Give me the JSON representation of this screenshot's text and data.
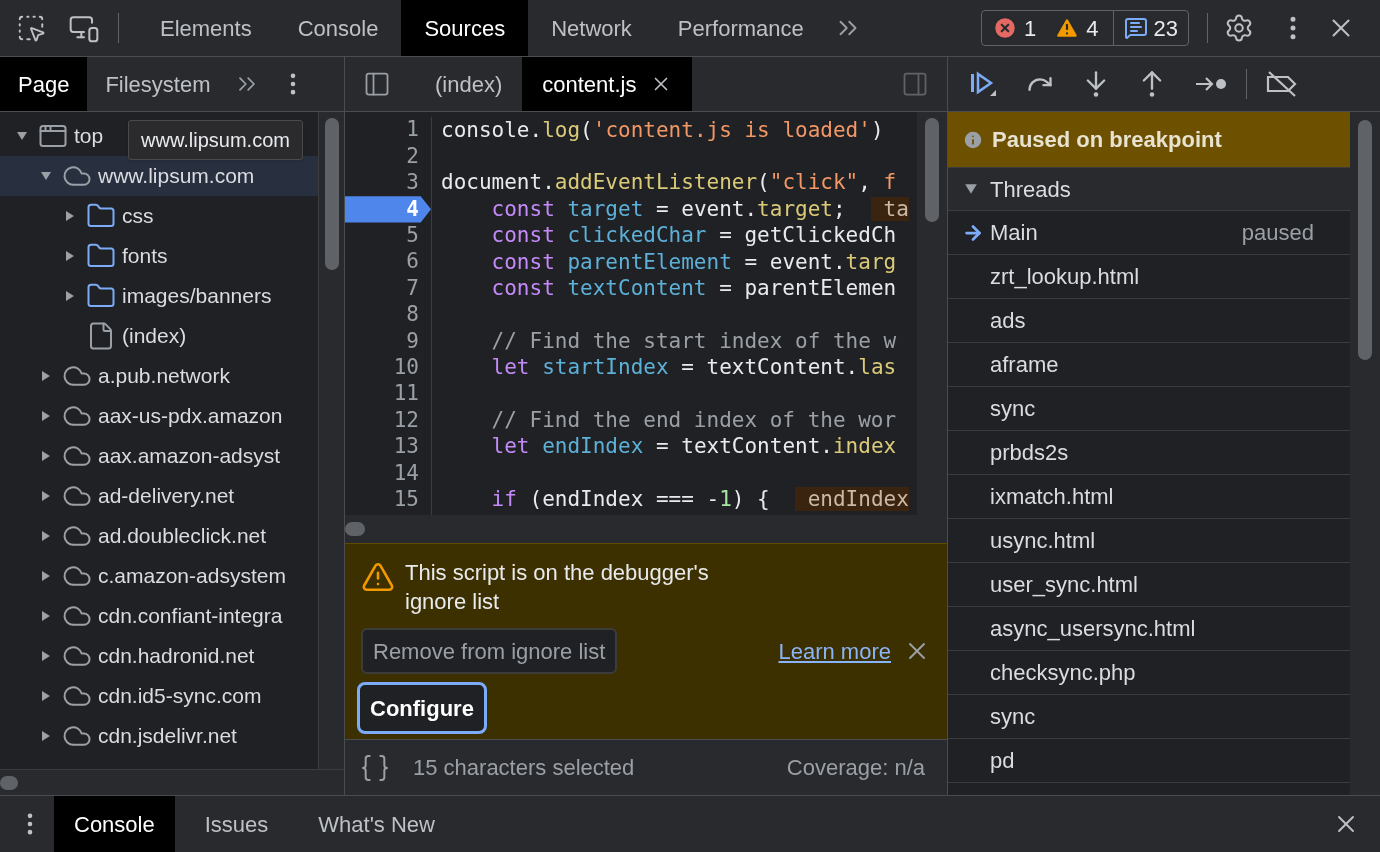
{
  "main_tabs": [
    {
      "label": "Elements",
      "selected": false
    },
    {
      "label": "Console",
      "selected": false
    },
    {
      "label": "Sources",
      "selected": true
    },
    {
      "label": "Network",
      "selected": false
    },
    {
      "label": "Performance",
      "selected": false
    }
  ],
  "counts": {
    "errors": "1",
    "warnings": "4",
    "messages": "23"
  },
  "navigator": {
    "tabs": [
      {
        "label": "Page",
        "selected": true
      },
      {
        "label": "Filesystem",
        "selected": false
      }
    ],
    "tooltip": "www.lipsum.com",
    "tree": [
      {
        "label": "top",
        "kind": "frame",
        "expanded": true,
        "selected": false,
        "children": [
          {
            "label": "www.lipsum.com",
            "kind": "domain",
            "expanded": true,
            "selected": true,
            "children": [
              {
                "label": "css",
                "kind": "folder",
                "expanded": false,
                "selected": false
              },
              {
                "label": "fonts",
                "kind": "folder",
                "expanded": false,
                "selected": false
              },
              {
                "label": "images/banners",
                "kind": "folder",
                "expanded": false,
                "selected": false
              },
              {
                "label": "(index)",
                "kind": "file",
                "selected": false
              }
            ]
          },
          {
            "label": "a.pub.network",
            "kind": "domain",
            "expanded": false,
            "selected": false
          },
          {
            "label": "aax-us-pdx.amazon",
            "kind": "domain",
            "expanded": false,
            "selected": false
          },
          {
            "label": "aax.amazon-adsyst",
            "kind": "domain",
            "expanded": false,
            "selected": false
          },
          {
            "label": "ad-delivery.net",
            "kind": "domain",
            "expanded": false,
            "selected": false
          },
          {
            "label": "ad.doubleclick.net",
            "kind": "domain",
            "expanded": false,
            "selected": false
          },
          {
            "label": "c.amazon-adsystem",
            "kind": "domain",
            "expanded": false,
            "selected": false
          },
          {
            "label": "cdn.confiant-integra",
            "kind": "domain",
            "expanded": false,
            "selected": false
          },
          {
            "label": "cdn.hadronid.net",
            "kind": "domain",
            "expanded": false,
            "selected": false
          },
          {
            "label": "cdn.id5-sync.com",
            "kind": "domain",
            "expanded": false,
            "selected": false
          },
          {
            "label": "cdn.jsdelivr.net",
            "kind": "domain",
            "expanded": false,
            "selected": false
          }
        ]
      }
    ]
  },
  "editor": {
    "tabs": [
      {
        "label": "(index)",
        "selected": false,
        "closable": false
      },
      {
        "label": "content.js",
        "selected": true,
        "closable": true
      }
    ],
    "lines": [
      {
        "number": "1",
        "breakpoint": false,
        "tokens": [
          {
            "text": "console.",
            "kind": "plain"
          },
          {
            "text": "log",
            "kind": "property"
          },
          {
            "text": "(",
            "kind": "plain"
          },
          {
            "text": "'content.js is loaded'",
            "kind": "string"
          },
          {
            "text": ")",
            "kind": "plain"
          }
        ]
      },
      {
        "number": "2",
        "breakpoint": false
      },
      {
        "number": "3",
        "breakpoint": false,
        "tokens": [
          {
            "text": "document.",
            "kind": "plain"
          },
          {
            "text": "addEventListener",
            "kind": "property"
          },
          {
            "text": "(",
            "kind": "plain"
          },
          {
            "text": "\"click\"",
            "kind": "string"
          },
          {
            "text": ", ",
            "kind": "plain"
          },
          {
            "text": "f",
            "kind": "string"
          }
        ]
      },
      {
        "number": "4",
        "breakpoint": true,
        "tokens": [
          {
            "text": "    const",
            "kind": "keyword"
          },
          {
            "text": " target",
            "kind": "variable"
          },
          {
            "text": " = event.",
            "kind": "plain"
          },
          {
            "text": "target",
            "kind": "property"
          },
          {
            "text": ";  ",
            "kind": "plain"
          },
          {
            "text": " ta",
            "kind": "inline"
          }
        ]
      },
      {
        "number": "5",
        "breakpoint": false,
        "tokens": [
          {
            "text": "    const",
            "kind": "keyword"
          },
          {
            "text": " clickedChar",
            "kind": "variable"
          },
          {
            "text": " = getClickedCh",
            "kind": "plain"
          }
        ]
      },
      {
        "number": "6",
        "breakpoint": false,
        "tokens": [
          {
            "text": "    const",
            "kind": "keyword"
          },
          {
            "text": " parentElement",
            "kind": "variable"
          },
          {
            "text": " = event.",
            "kind": "plain"
          },
          {
            "text": "targ",
            "kind": "property"
          }
        ]
      },
      {
        "number": "7",
        "breakpoint": false,
        "tokens": [
          {
            "text": "    const",
            "kind": "keyword"
          },
          {
            "text": " textContent",
            "kind": "variable"
          },
          {
            "text": " = parentElemen",
            "kind": "plain"
          }
        ]
      },
      {
        "number": "8",
        "breakpoint": false
      },
      {
        "number": "9",
        "breakpoint": false,
        "tokens": [
          {
            "text": "    // Find the start index of the w",
            "kind": "comment"
          }
        ]
      },
      {
        "number": "10",
        "breakpoint": false,
        "tokens": [
          {
            "text": "    let",
            "kind": "keyword"
          },
          {
            "text": " startIndex",
            "kind": "variable"
          },
          {
            "text": " = textContent.",
            "kind": "plain"
          },
          {
            "text": "las",
            "kind": "property"
          }
        ]
      },
      {
        "number": "11",
        "breakpoint": false
      },
      {
        "number": "12",
        "breakpoint": false,
        "tokens": [
          {
            "text": "    // Find the end index of the wor",
            "kind": "comment"
          }
        ]
      },
      {
        "number": "13",
        "breakpoint": false,
        "tokens": [
          {
            "text": "    let",
            "kind": "keyword"
          },
          {
            "text": " endIndex",
            "kind": "variable"
          },
          {
            "text": " = textContent.",
            "kind": "plain"
          },
          {
            "text": "index",
            "kind": "property"
          }
        ]
      },
      {
        "number": "14",
        "breakpoint": false
      },
      {
        "number": "15",
        "breakpoint": false,
        "tokens": [
          {
            "text": "    if",
            "kind": "keyword"
          },
          {
            "text": " (endIndex === -",
            "kind": "plain"
          },
          {
            "text": "1",
            "kind": "number"
          },
          {
            "text": ") {  ",
            "kind": "plain"
          },
          {
            "text": " endIndex",
            "kind": "inline"
          }
        ]
      }
    ],
    "infobar": {
      "message": "This script is on the debugger's ignore list",
      "buttons": [
        {
          "label": "Remove from ignore list",
          "focused": false
        },
        {
          "label": "Configure",
          "focused": true
        }
      ],
      "link": "Learn more"
    },
    "status": {
      "selection": "15 characters selected",
      "coverage": "Coverage: n/a"
    }
  },
  "debugger": {
    "banner": "Paused on breakpoint",
    "threads": {
      "title": "Threads",
      "expanded": true,
      "items": [
        {
          "name": "Main",
          "status": "paused",
          "selected": true
        },
        {
          "name": "zrt_lookup.html",
          "selected": false
        },
        {
          "name": "ads",
          "selected": false
        },
        {
          "name": "aframe",
          "selected": false
        },
        {
          "name": "sync",
          "selected": false
        },
        {
          "name": "prbds2s",
          "selected": false
        },
        {
          "name": "ixmatch.html",
          "selected": false
        },
        {
          "name": "usync.html",
          "selected": false
        },
        {
          "name": "user_sync.html",
          "selected": false
        },
        {
          "name": "async_usersync.html",
          "selected": false
        },
        {
          "name": "checksync.php",
          "selected": false
        },
        {
          "name": "sync",
          "selected": false
        },
        {
          "name": "pd",
          "selected": false
        }
      ]
    }
  },
  "drawer": {
    "tabs": [
      {
        "label": "Console",
        "selected": true
      },
      {
        "label": "Issues",
        "selected": false
      },
      {
        "label": "What's New",
        "selected": false
      }
    ]
  }
}
